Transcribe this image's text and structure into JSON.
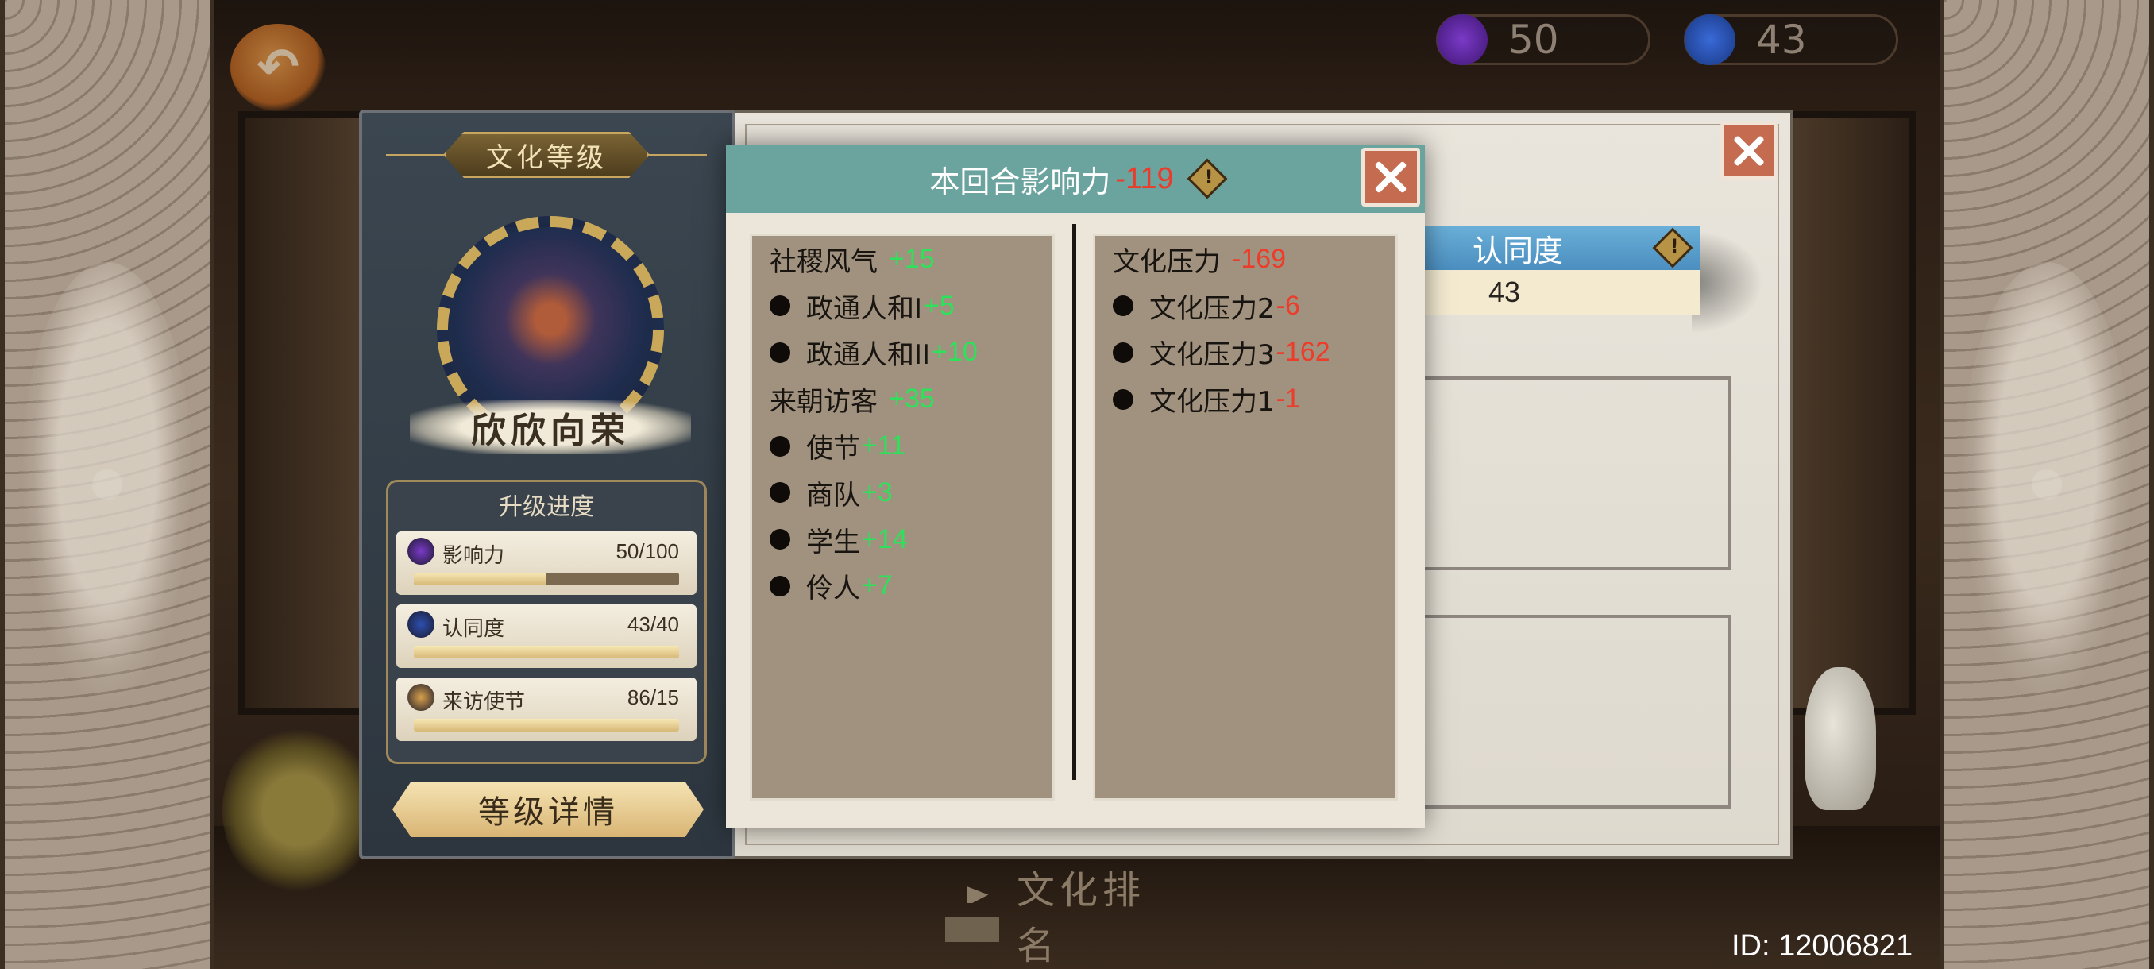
{
  "top_bar": {
    "influence_value": "50",
    "recognition_value": "43"
  },
  "culture_panel": {
    "title": "文化等级",
    "level_name": "欣欣向荣",
    "progress_heading": "升级进度",
    "progress_items": [
      {
        "label": "影响力",
        "value": "50/100",
        "progress": 0.5,
        "icon": "influence-icon",
        "icon_color": "#7a3ac8"
      },
      {
        "label": "认同度",
        "value": "43/40",
        "progress": 1.0,
        "icon": "recognition-icon",
        "icon_color": "#2d4fb0"
      },
      {
        "label": "来访使节",
        "value": "86/15",
        "progress": 1.0,
        "icon": "envoy-icon",
        "icon_color": "#d8a04c"
      }
    ],
    "detail_button": "等级详情"
  },
  "paper_panel": {
    "recognition_tab": "认同度",
    "recognition_value": "43"
  },
  "influence_popup": {
    "title": "本回合影响力",
    "total": "-119",
    "left_column": [
      {
        "type": "head",
        "label": "社稷风气",
        "value": "+15",
        "sign": "pos"
      },
      {
        "type": "sub",
        "label": "政通人和I",
        "value": "+5",
        "sign": "pos"
      },
      {
        "type": "sub",
        "label": "政通人和II",
        "value": "+10",
        "sign": "pos"
      },
      {
        "type": "head",
        "label": "来朝访客",
        "value": "+35",
        "sign": "pos"
      },
      {
        "type": "sub",
        "label": "使节",
        "value": "+11",
        "sign": "pos"
      },
      {
        "type": "sub",
        "label": "商队",
        "value": "+3",
        "sign": "pos"
      },
      {
        "type": "sub",
        "label": "学生",
        "value": "+14",
        "sign": "pos"
      },
      {
        "type": "sub",
        "label": "伶人",
        "value": "+7",
        "sign": "pos"
      }
    ],
    "right_column": [
      {
        "type": "head",
        "label": "文化压力",
        "value": "-169",
        "sign": "neg"
      },
      {
        "type": "sub",
        "label": "文化压力2",
        "value": "-6",
        "sign": "neg"
      },
      {
        "type": "sub",
        "label": "文化压力3",
        "value": "-162",
        "sign": "neg"
      },
      {
        "type": "sub",
        "label": "文化压力1",
        "value": "-1",
        "sign": "neg"
      }
    ]
  },
  "bottom": {
    "rank_button": "文化排名",
    "player_id": "ID: 12006821"
  },
  "colors": {
    "positive": "#2fe05a",
    "negative": "#ec3c2a",
    "popup_header": "#6ba39f"
  }
}
